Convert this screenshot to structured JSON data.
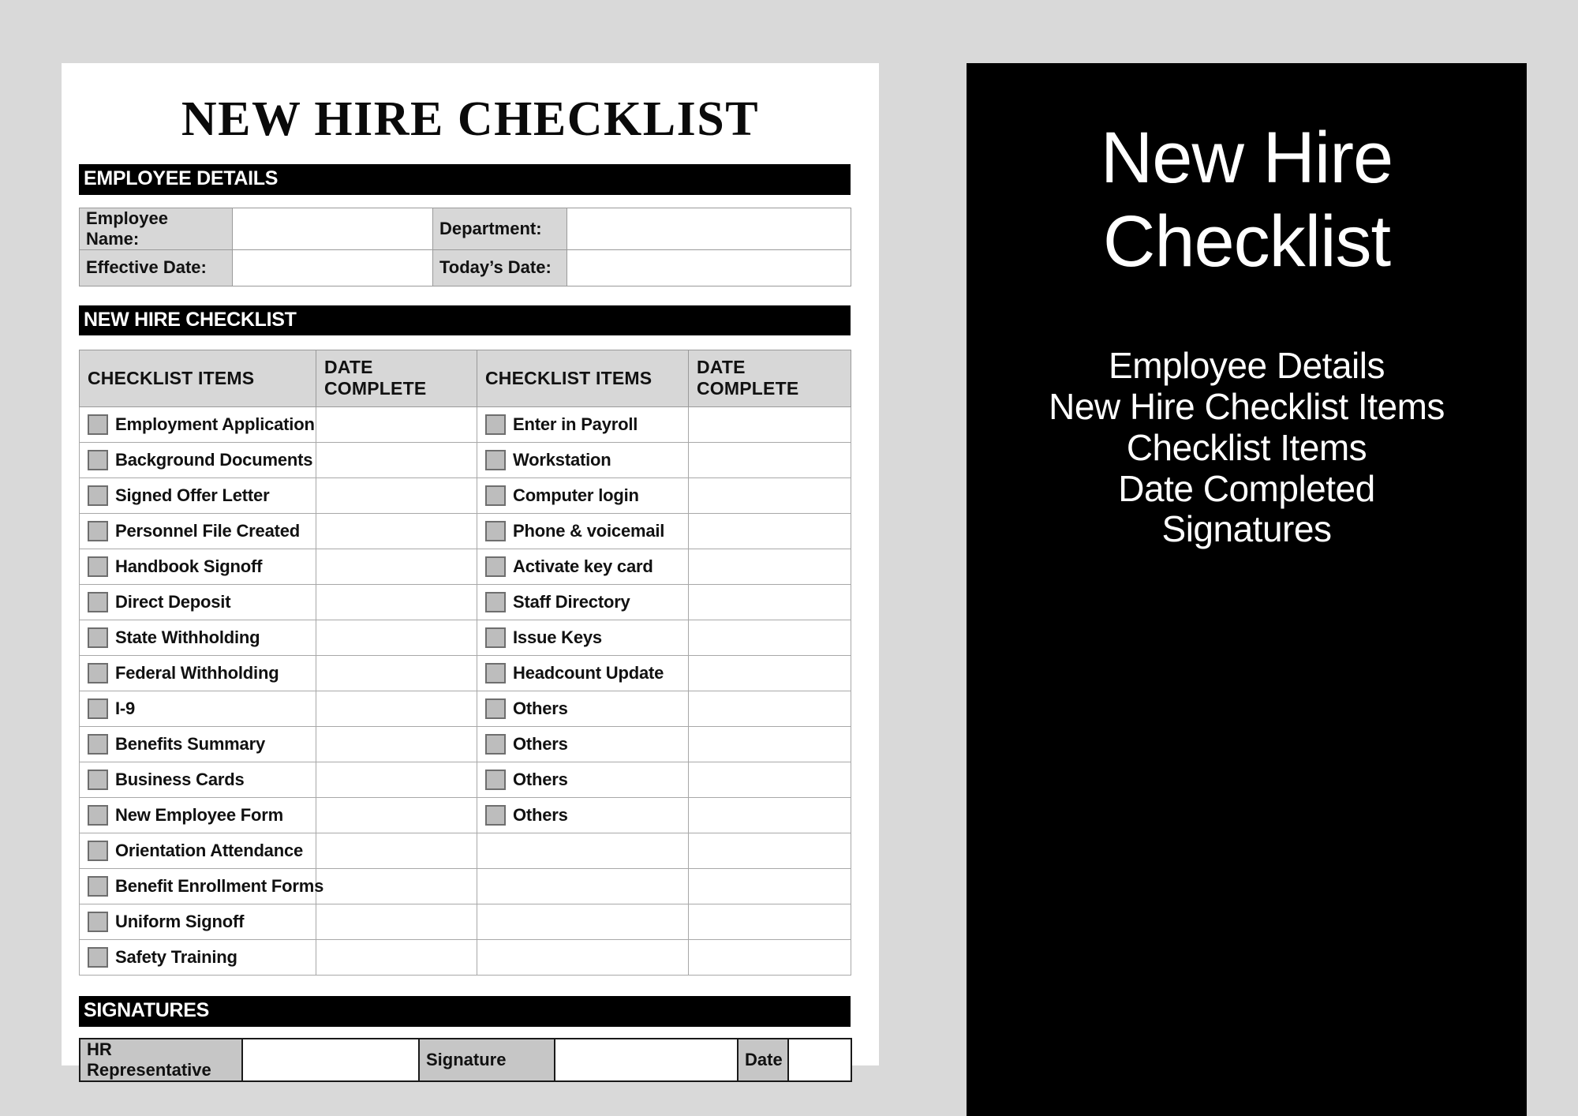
{
  "document": {
    "title": "NEW HIRE CHECKLIST",
    "sections": {
      "employee_details": "EMPLOYEE DETAILS",
      "new_hire_checklist": "NEW HIRE CHECKLIST",
      "signatures": "SIGNATURES"
    },
    "employee_details": {
      "employee_name_label": "Employee Name:",
      "employee_name_value": "",
      "department_label": "Department:",
      "department_value": "",
      "effective_date_label": "Effective Date:",
      "effective_date_value": "",
      "todays_date_label": "Today’s Date:",
      "todays_date_value": ""
    },
    "checklist": {
      "headers": [
        "CHECKLIST ITEMS",
        "DATE COMPLETE",
        "CHECKLIST ITEMS",
        "DATE COMPLETE"
      ],
      "rows": [
        {
          "left": "Employment Application",
          "left_date": "",
          "right": "Enter in Payroll",
          "right_date": ""
        },
        {
          "left": "Background Documents",
          "left_date": "",
          "right": "Workstation",
          "right_date": ""
        },
        {
          "left": "Signed Offer Letter",
          "left_date": "",
          "right": "Computer login",
          "right_date": ""
        },
        {
          "left": "Personnel File Created",
          "left_date": "",
          "right": "Phone & voicemail",
          "right_date": ""
        },
        {
          "left": "Handbook Signoff",
          "left_date": "",
          "right": "Activate key card",
          "right_date": ""
        },
        {
          "left": "Direct Deposit",
          "left_date": "",
          "right": "Staff Directory",
          "right_date": ""
        },
        {
          "left": "State Withholding",
          "left_date": "",
          "right": "Issue Keys",
          "right_date": ""
        },
        {
          "left": "Federal Withholding",
          "left_date": "",
          "right": "Headcount Update",
          "right_date": ""
        },
        {
          "left": "I-9",
          "left_date": "",
          "right": "Others",
          "right_date": ""
        },
        {
          "left": "Benefits Summary",
          "left_date": "",
          "right": "Others",
          "right_date": ""
        },
        {
          "left": "Business Cards",
          "left_date": "",
          "right": "Others",
          "right_date": ""
        },
        {
          "left": "New Employee Form",
          "left_date": "",
          "right": "Others",
          "right_date": ""
        },
        {
          "left": "Orientation Attendance",
          "left_date": "",
          "right": "",
          "right_date": ""
        },
        {
          "left": "Benefit Enrollment Forms",
          "left_date": "",
          "right": "",
          "right_date": ""
        },
        {
          "left": "Uniform Signoff",
          "left_date": "",
          "right": "",
          "right_date": ""
        },
        {
          "left": "Safety Training",
          "left_date": "",
          "right": "",
          "right_date": ""
        }
      ]
    },
    "signature_row": {
      "hr_representative_label": "HR Representative",
      "hr_representative_value": "",
      "signature_label": "Signature",
      "signature_value": "",
      "date_label": "Date",
      "date_value": ""
    }
  },
  "summary_panel": {
    "title": "New Hire Checklist",
    "lines": [
      "Employee Details",
      "New Hire Checklist Items",
      "Checklist Items",
      "Date Completed",
      "Signatures"
    ]
  },
  "colors": {
    "page_background": "#d9d9d9",
    "document_background": "#ffffff",
    "section_bar": "#000000",
    "section_bar_text": "#ffffff",
    "header_cell": "#d7d7d7",
    "checkbox_fill": "#bdbdbd",
    "checkbox_border": "#6e6e6e",
    "panel_background": "#000000",
    "panel_text": "#ffffff"
  }
}
